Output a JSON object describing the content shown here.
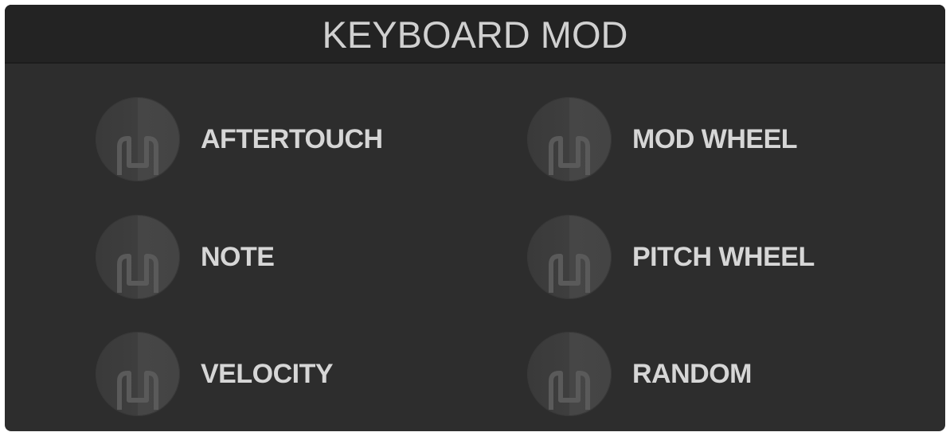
{
  "panel": {
    "title": "KEYBOARD MOD"
  },
  "mod_sources": [
    {
      "label": "AFTERTOUCH"
    },
    {
      "label": "MOD WHEEL"
    },
    {
      "label": "NOTE"
    },
    {
      "label": "PITCH WHEEL"
    },
    {
      "label": "VELOCITY"
    },
    {
      "label": "RANDOM"
    }
  ],
  "colors": {
    "panel_background": "#2d2d2d",
    "header_background": "#232323",
    "text": "#d6d6d6",
    "knob_dark": "#3a3a3a",
    "knob_light": "#464646",
    "knob_glyph": "#5a5a5a"
  },
  "icons": {
    "mod_source_knob": "mod-source-icon"
  }
}
